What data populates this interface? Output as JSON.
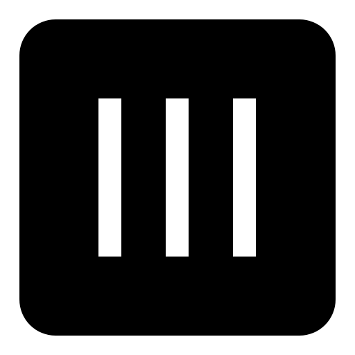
{
  "icon": {
    "name": "three-vertical-bars-icon",
    "description_colors": {
      "background": "#ffffff",
      "tile": "#000000",
      "bars": "#ffffff"
    },
    "bar_count": 3
  }
}
